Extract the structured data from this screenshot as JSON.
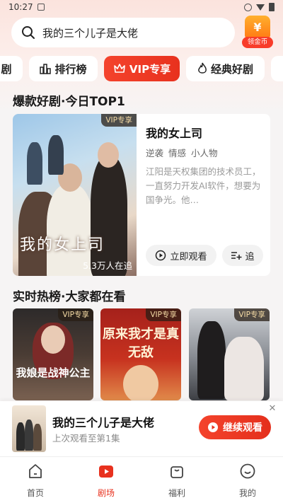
{
  "status_bar": {
    "time": "10:27"
  },
  "search": {
    "query": "我的三个儿子是大佬"
  },
  "coin": {
    "symbol": "¥",
    "label": "领金币"
  },
  "tabs": [
    {
      "label": "剧",
      "active": false
    },
    {
      "label": "排行榜",
      "active": false
    },
    {
      "label": "VIP专享",
      "active": true
    },
    {
      "label": "经典好剧",
      "active": false
    }
  ],
  "section_top": {
    "title": "爆款好剧·今日TOP1"
  },
  "hero": {
    "vip": "VIP专享",
    "poster_art": "我的女上司",
    "watch_count": "5.3万人在追",
    "name": "我的女上司",
    "tags": "逆袭 情感 小人物",
    "description": "江阳是天权集团的技术员工，一直努力开发AI软件，想要为国争光。他…",
    "watch_button": "立即观看",
    "follow_button": "追"
  },
  "section_hot": {
    "title": "实时热榜·大家都在看"
  },
  "hot_list": [
    {
      "vip": "VIP专享",
      "art": "我娘是战神公主"
    },
    {
      "vip": "VIP专享",
      "art": "原来我才是真无敌"
    },
    {
      "vip": "VIP专享",
      "art": ""
    }
  ],
  "continue_watching": {
    "title": "我的三个儿子是大佬",
    "subtitle": "上次观看至第1集",
    "button": "继续观看"
  },
  "bottom_nav": [
    {
      "label": "首页",
      "active": false
    },
    {
      "label": "剧场",
      "active": true
    },
    {
      "label": "福利",
      "active": false
    },
    {
      "label": "我的",
      "active": false
    }
  ],
  "colors": {
    "accent": "#e8311e",
    "vip_gold": "#f6dca6"
  }
}
